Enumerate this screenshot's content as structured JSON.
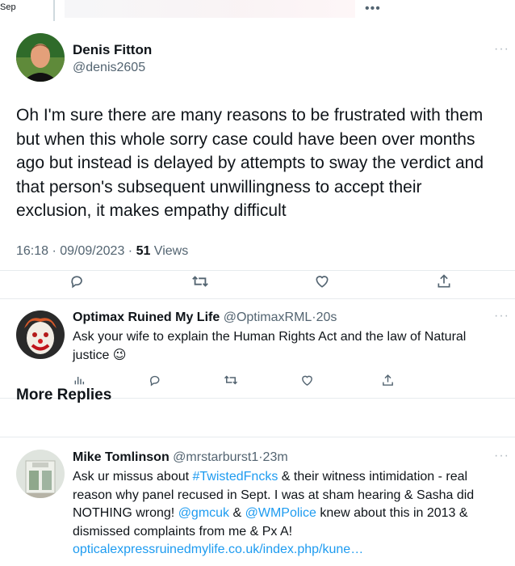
{
  "top": {
    "sep_label": "Sep"
  },
  "main_tweet": {
    "name": "Denis Fitton",
    "handle": "@denis2605",
    "text": "Oh I'm sure there are many reasons to be frustrated with them but when this whole sorry case could have been over months ago but instead is delayed by attempts to sway the verdict and that person's subsequent unwillingness to accept their exclusion, it makes empathy difficult",
    "time_date": "16:18 · 09/09/2023 · ",
    "views_count": "51",
    "views_label": " Views"
  },
  "reply1": {
    "name": "Optimax Ruined My Life",
    "handle": "@OptimaxRML",
    "sep": "·",
    "time": "20s",
    "text": "Ask your wife to explain the Human Rights Act and the law of Natural justice ",
    "emoji": "😉"
  },
  "section": {
    "title": "More Replies"
  },
  "reply2": {
    "name": "Mike Tomlinson",
    "handle": "@mrstarburst1",
    "sep": "·",
    "time": "23m",
    "text_a": "Ask ur missus about ",
    "hashtag": "#TwistedFncks",
    "text_b": " & their witness intimidation - real reason why panel recused in Sept. I was at sham hearing & Sasha did NOTHING wrong! ",
    "mention1": "@gmcuk",
    "text_c": " & ",
    "mention2": "@WMPolice",
    "text_d": " knew about this in 2013 & dismissed complaints from me & Px A! ",
    "url": "opticalexpressruinedmylife.co.uk/index.php/kune…"
  },
  "icons": {
    "more": "more-horizontal-icon",
    "reply": "reply-icon",
    "retweet": "retweet-icon",
    "like": "heart-icon",
    "share": "share-icon",
    "analytics": "analytics-icon"
  },
  "colors": {
    "link": "#1d9bf0",
    "secondary": "#536471",
    "text": "#0f1419",
    "divider": "#e7ebee"
  }
}
